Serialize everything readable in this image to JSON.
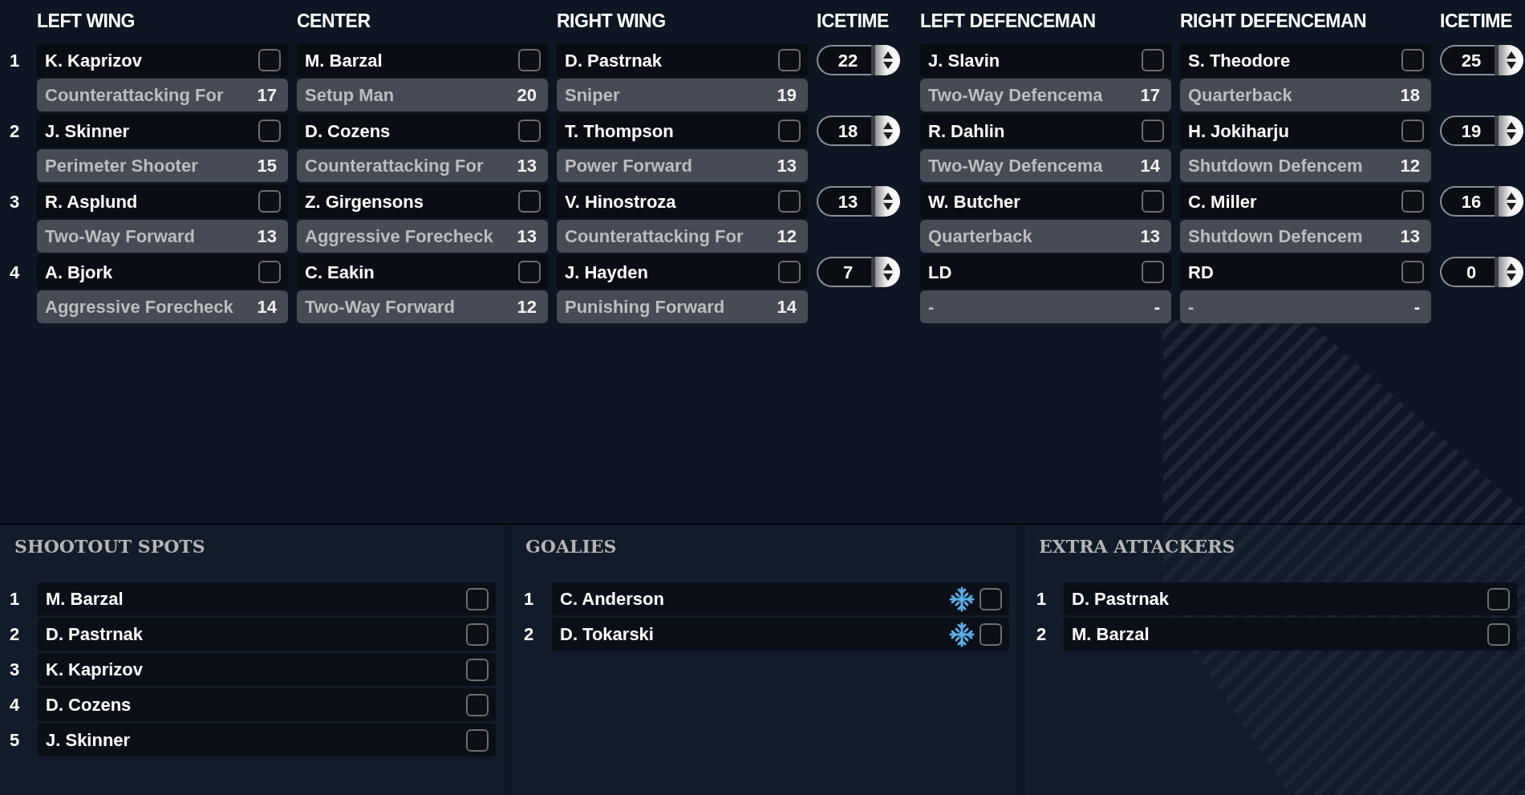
{
  "lineup": {
    "headings": [
      "LEFT WING",
      "CENTER",
      "RIGHT WING",
      "ICETIME",
      "LEFT DEFENCEMAN",
      "RIGHT DEFENCEMAN",
      "ICETIME"
    ],
    "rows": [
      {
        "number": "1",
        "forwards": [
          {
            "name": "K. Kaprizov",
            "checked": false,
            "role": "Counterattacking For",
            "rating": "17"
          },
          {
            "name": "M. Barzal",
            "checked": false,
            "role": "Setup Man",
            "rating": "20"
          },
          {
            "name": "D. Pastrnak",
            "checked": false,
            "role": "Sniper",
            "rating": "19"
          }
        ],
        "forward_icetime": "22",
        "defence": [
          {
            "name": "J. Slavin",
            "checked": false,
            "role": "Two-Way Defencema",
            "rating": "17"
          },
          {
            "name": "S. Theodore",
            "checked": false,
            "role": "Quarterback",
            "rating": "18"
          }
        ],
        "defence_icetime": "25"
      },
      {
        "number": "2",
        "forwards": [
          {
            "name": "J. Skinner",
            "checked": false,
            "role": "Perimeter Shooter",
            "rating": "15"
          },
          {
            "name": "D. Cozens",
            "checked": false,
            "role": "Counterattacking For",
            "rating": "13"
          },
          {
            "name": "T. Thompson",
            "checked": false,
            "role": "Power Forward",
            "rating": "13"
          }
        ],
        "forward_icetime": "18",
        "defence": [
          {
            "name": "R. Dahlin",
            "checked": false,
            "role": "Two-Way Defencema",
            "rating": "14"
          },
          {
            "name": "H. Jokiharju",
            "checked": false,
            "role": "Shutdown Defencem",
            "rating": "12"
          }
        ],
        "defence_icetime": "19"
      },
      {
        "number": "3",
        "forwards": [
          {
            "name": "R. Asplund",
            "checked": false,
            "role": "Two-Way Forward",
            "rating": "13"
          },
          {
            "name": "Z. Girgensons",
            "checked": false,
            "role": "Aggressive Forecheck",
            "rating": "13"
          },
          {
            "name": "V. Hinostroza",
            "checked": false,
            "role": "Counterattacking For",
            "rating": "12"
          }
        ],
        "forward_icetime": "13",
        "defence": [
          {
            "name": "W. Butcher",
            "checked": false,
            "role": "Quarterback",
            "rating": "13"
          },
          {
            "name": "C. Miller",
            "checked": false,
            "role": "Shutdown Defencem",
            "rating": "13"
          }
        ],
        "defence_icetime": "16"
      },
      {
        "number": "4",
        "forwards": [
          {
            "name": "A. Bjork",
            "checked": false,
            "role": "Aggressive Forecheck",
            "rating": "14"
          },
          {
            "name": "C. Eakin",
            "checked": false,
            "role": "Two-Way Forward",
            "rating": "12"
          },
          {
            "name": "J. Hayden",
            "checked": false,
            "role": "Punishing Forward",
            "rating": "14"
          }
        ],
        "forward_icetime": "7",
        "defence": [
          {
            "name": "LD",
            "checked": false,
            "role": "-",
            "rating": "-"
          },
          {
            "name": "RD",
            "checked": false,
            "role": "-",
            "rating": "-"
          }
        ],
        "defence_icetime": "0"
      }
    ]
  },
  "panels": [
    {
      "kind": "shootout",
      "title": "SHOOTOUT SPOTS",
      "players": [
        {
          "number": "1",
          "name": "M. Barzal",
          "checked": false
        },
        {
          "number": "2",
          "name": "D. Pastrnak",
          "checked": false
        },
        {
          "number": "3",
          "name": "K. Kaprizov",
          "checked": false
        },
        {
          "number": "4",
          "name": "D. Cozens",
          "checked": false
        },
        {
          "number": "5",
          "name": "J. Skinner",
          "checked": false
        }
      ]
    },
    {
      "kind": "goalies",
      "title": "GOALIES",
      "players": [
        {
          "number": "1",
          "name": "C. Anderson",
          "checked": false
        },
        {
          "number": "2",
          "name": "D. Tokarski",
          "checked": false
        }
      ]
    },
    {
      "kind": "extra_attackers",
      "title": "EXTRA ATTACKERS",
      "players": [
        {
          "number": "1",
          "name": "D. Pastrnak",
          "checked": false
        },
        {
          "number": "2",
          "name": "M. Barzal",
          "checked": false
        }
      ]
    }
  ]
}
